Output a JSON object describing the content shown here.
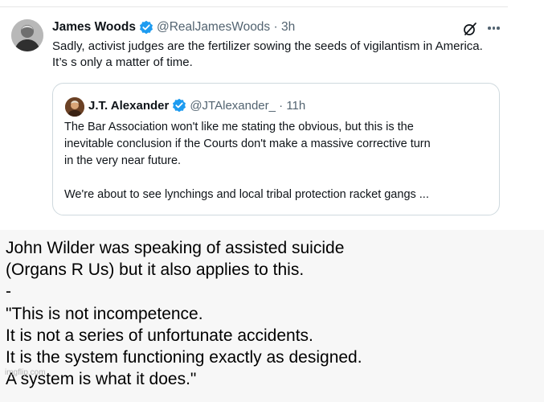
{
  "main_tweet": {
    "author_name": "James Woods",
    "handle_time": "@RealJamesWoods · 3h",
    "text": "Sadly, activist judges are the fertilizer sowing the seeds of vigilantism in America. It’s s only a matter of time.",
    "avatar_icon": "person-avatar-icon",
    "verified_icon": "verified-badge-icon",
    "grok_icon": "slashed-circle-icon",
    "more_icon": "more-options-icon"
  },
  "quoted_tweet": {
    "author_name": "J.T. Alexander",
    "handle_time": "@JTAlexander_ · 11h",
    "text_lines": [
      "The Bar Association won't like me stating the obvious, but this is the",
      "inevitable conclusion if the Courts don't make a massive corrective turn",
      "in the very near future.",
      "We're about to see lynchings and local tribal protection racket gangs ..."
    ],
    "avatar_icon": "portrait-avatar-icon",
    "verified_icon": "verified-badge-icon"
  },
  "caption": {
    "lines": [
      "John Wilder was speaking of assisted suicide",
      "(Organs R Us) but it also applies to this.",
      "-",
      "\"This is not incompetence.",
      "It is not a series of unfortunate accidents.",
      "It is the system functioning exactly as designed.",
      "A system is what it does.\""
    ]
  },
  "watermark": "imgflip.com",
  "colors": {
    "verified": "#1d9bf0",
    "text": "#0f1419",
    "muted": "#536471",
    "border": "#cfd9de",
    "caption_bg": "#f7f7f7"
  }
}
